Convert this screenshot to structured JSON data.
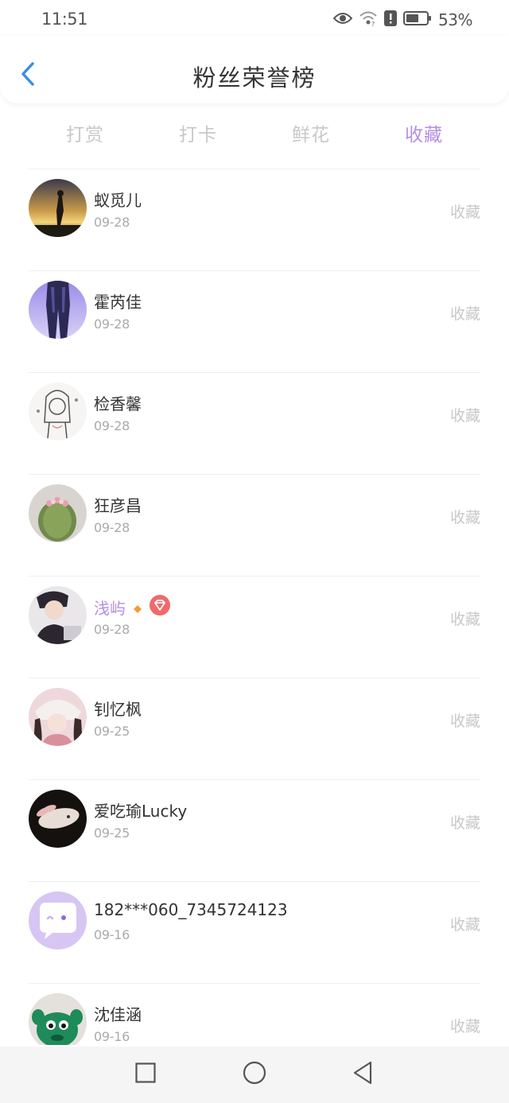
{
  "status_bar": {
    "time": "11:51",
    "battery_percent": "53%",
    "icons": [
      "eye-icon",
      "wifi-icon",
      "alert-icon",
      "battery-icon"
    ]
  },
  "header": {
    "title": "粉丝荣誉榜",
    "back_icon": "chevron-left-icon"
  },
  "tabs": [
    {
      "label": "打赏",
      "active": false
    },
    {
      "label": "打卡",
      "active": false
    },
    {
      "label": "鲜花",
      "active": false
    },
    {
      "label": "收藏",
      "active": true
    }
  ],
  "colors": {
    "accent": "#b58ee6",
    "muted": "#c8c8c8",
    "badge": "#f06a6a",
    "diamond": "#f39c32"
  },
  "fans": [
    {
      "name": "蚁觅儿",
      "date": "09-28",
      "action": "收藏"
    },
    {
      "name": "霍芮佳",
      "date": "09-28",
      "action": "收藏"
    },
    {
      "name": "检香馨",
      "date": "09-28",
      "action": "收藏"
    },
    {
      "name": "狂彦昌",
      "date": "09-28",
      "action": "收藏"
    },
    {
      "name": "浅屿",
      "date": "09-28",
      "action": "收藏",
      "vip": true
    },
    {
      "name": "钊忆枫",
      "date": "09-25",
      "action": "收藏"
    },
    {
      "name": "爱吃瑜Lucky",
      "date": "09-25",
      "action": "收藏"
    },
    {
      "name": "182***060_7345724123",
      "date": "09-16",
      "action": "收藏"
    },
    {
      "name": "沈佳涵",
      "date": "09-16",
      "action": "收藏"
    }
  ],
  "nav_bar": {
    "icons": [
      "square-icon",
      "circle-icon",
      "triangle-back-icon"
    ]
  }
}
